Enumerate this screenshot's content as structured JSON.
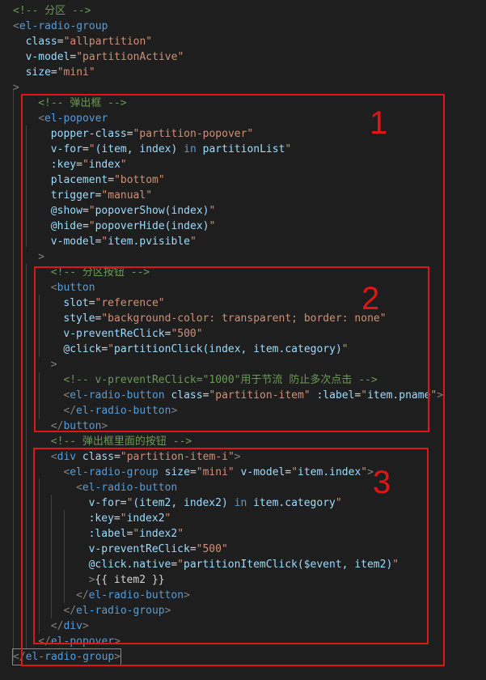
{
  "colors": {
    "background": "#1e1e1e",
    "comment": "#6a9955",
    "tag": "#569cd6",
    "attribute": "#9cdcfe",
    "string": "#ce9178",
    "text": "#d4d4d4",
    "punctuation": "#808080",
    "annotation": "#e01515"
  },
  "annotations": [
    {
      "number": "1"
    },
    {
      "number": "2"
    },
    {
      "number": "3"
    }
  ],
  "code_lines": [
    {
      "indent": 0,
      "tokens": [
        {
          "t": "c",
          "v": "<!-- 分区 -->"
        }
      ]
    },
    {
      "indent": 0,
      "tokens": [
        {
          "t": "p",
          "v": "<"
        },
        {
          "t": "g",
          "v": "el-radio-group"
        }
      ]
    },
    {
      "indent": 1,
      "tokens": [
        {
          "t": "a",
          "v": "class"
        },
        {
          "t": "x",
          "v": "="
        },
        {
          "t": "s",
          "v": "\"allpartition\""
        }
      ]
    },
    {
      "indent": 1,
      "tokens": [
        {
          "t": "a",
          "v": "v-model"
        },
        {
          "t": "x",
          "v": "="
        },
        {
          "t": "s",
          "v": "\"partitionActive\""
        }
      ]
    },
    {
      "indent": 1,
      "tokens": [
        {
          "t": "a",
          "v": "size"
        },
        {
          "t": "x",
          "v": "="
        },
        {
          "t": "s",
          "v": "\"mini\""
        }
      ]
    },
    {
      "indent": 0,
      "tokens": [
        {
          "t": "p",
          "v": ">"
        }
      ]
    },
    {
      "indent": 2,
      "tokens": [
        {
          "t": "c",
          "v": "<!-- 弹出框 -->"
        }
      ]
    },
    {
      "indent": 2,
      "tokens": [
        {
          "t": "p",
          "v": "<"
        },
        {
          "t": "g",
          "v": "el-popover"
        }
      ]
    },
    {
      "indent": 3,
      "tokens": [
        {
          "t": "a",
          "v": "popper-class"
        },
        {
          "t": "x",
          "v": "="
        },
        {
          "t": "s",
          "v": "\"partition-popover\""
        }
      ]
    },
    {
      "indent": 3,
      "tokens": [
        {
          "t": "a",
          "v": "v-for"
        },
        {
          "t": "x",
          "v": "="
        },
        {
          "t": "s",
          "v": "\""
        },
        {
          "t": "a",
          "v": "(item, index) "
        },
        {
          "t": "g",
          "v": "in"
        },
        {
          "t": "a",
          "v": " partitionList"
        },
        {
          "t": "s",
          "v": "\""
        }
      ]
    },
    {
      "indent": 3,
      "tokens": [
        {
          "t": "a",
          "v": ":key"
        },
        {
          "t": "x",
          "v": "="
        },
        {
          "t": "s",
          "v": "\""
        },
        {
          "t": "a",
          "v": "index"
        },
        {
          "t": "s",
          "v": "\""
        }
      ]
    },
    {
      "indent": 3,
      "tokens": [
        {
          "t": "a",
          "v": "placement"
        },
        {
          "t": "x",
          "v": "="
        },
        {
          "t": "s",
          "v": "\"bottom\""
        }
      ]
    },
    {
      "indent": 3,
      "tokens": [
        {
          "t": "a",
          "v": "trigger"
        },
        {
          "t": "x",
          "v": "="
        },
        {
          "t": "s",
          "v": "\"manual\""
        }
      ]
    },
    {
      "indent": 3,
      "tokens": [
        {
          "t": "a",
          "v": "@show"
        },
        {
          "t": "x",
          "v": "="
        },
        {
          "t": "s",
          "v": "\""
        },
        {
          "t": "a",
          "v": "popoverShow(index)"
        },
        {
          "t": "s",
          "v": "\""
        }
      ]
    },
    {
      "indent": 3,
      "tokens": [
        {
          "t": "a",
          "v": "@hide"
        },
        {
          "t": "x",
          "v": "="
        },
        {
          "t": "s",
          "v": "\""
        },
        {
          "t": "a",
          "v": "popoverHide(index)"
        },
        {
          "t": "s",
          "v": "\""
        }
      ]
    },
    {
      "indent": 3,
      "tokens": [
        {
          "t": "a",
          "v": "v-model"
        },
        {
          "t": "x",
          "v": "="
        },
        {
          "t": "s",
          "v": "\""
        },
        {
          "t": "a",
          "v": "item.pvisible"
        },
        {
          "t": "s",
          "v": "\""
        }
      ]
    },
    {
      "indent": 2,
      "tokens": [
        {
          "t": "p",
          "v": ">"
        }
      ]
    },
    {
      "indent": 3,
      "tokens": [
        {
          "t": "c",
          "v": "<!-- 分区按钮 -->"
        }
      ]
    },
    {
      "indent": 3,
      "tokens": [
        {
          "t": "p",
          "v": "<"
        },
        {
          "t": "g",
          "v": "button"
        }
      ]
    },
    {
      "indent": 4,
      "tokens": [
        {
          "t": "a",
          "v": "slot"
        },
        {
          "t": "x",
          "v": "="
        },
        {
          "t": "s",
          "v": "\"reference\""
        }
      ]
    },
    {
      "indent": 4,
      "tokens": [
        {
          "t": "a",
          "v": "style"
        },
        {
          "t": "x",
          "v": "="
        },
        {
          "t": "s",
          "v": "\"background-color: transparent; border: none\""
        }
      ]
    },
    {
      "indent": 4,
      "tokens": [
        {
          "t": "a",
          "v": "v-preventReClick"
        },
        {
          "t": "x",
          "v": "="
        },
        {
          "t": "s",
          "v": "\"500\""
        }
      ]
    },
    {
      "indent": 4,
      "tokens": [
        {
          "t": "a",
          "v": "@click"
        },
        {
          "t": "x",
          "v": "="
        },
        {
          "t": "s",
          "v": "\""
        },
        {
          "t": "a",
          "v": "partitionClick(index, item.category)"
        },
        {
          "t": "s",
          "v": "\""
        }
      ]
    },
    {
      "indent": 3,
      "tokens": [
        {
          "t": "p",
          "v": ">"
        }
      ]
    },
    {
      "indent": 4,
      "tokens": [
        {
          "t": "c",
          "v": "<!-- v-preventReClick=\"1000\"用于节流 防止多次点击 -->"
        }
      ]
    },
    {
      "indent": 4,
      "tokens": [
        {
          "t": "p",
          "v": "<"
        },
        {
          "t": "g",
          "v": "el-radio-button"
        },
        {
          "t": "a",
          "v": " class"
        },
        {
          "t": "x",
          "v": "="
        },
        {
          "t": "s",
          "v": "\"partition-item\""
        },
        {
          "t": "a",
          "v": " :label"
        },
        {
          "t": "x",
          "v": "="
        },
        {
          "t": "s",
          "v": "\""
        },
        {
          "t": "a",
          "v": "item.pname"
        },
        {
          "t": "s",
          "v": "\""
        },
        {
          "t": "p",
          "v": ">"
        }
      ]
    },
    {
      "indent": 4,
      "tokens": [
        {
          "t": "p",
          "v": "</"
        },
        {
          "t": "g",
          "v": "el-radio-button"
        },
        {
          "t": "p",
          "v": ">"
        }
      ]
    },
    {
      "indent": 3,
      "tokens": [
        {
          "t": "p",
          "v": "</"
        },
        {
          "t": "g",
          "v": "button"
        },
        {
          "t": "p",
          "v": ">"
        }
      ]
    },
    {
      "indent": 3,
      "tokens": [
        {
          "t": "c",
          "v": "<!-- 弹出框里面的按钮 -->"
        }
      ]
    },
    {
      "indent": 3,
      "tokens": [
        {
          "t": "p",
          "v": "<"
        },
        {
          "t": "g",
          "v": "div"
        },
        {
          "t": "a",
          "v": " class"
        },
        {
          "t": "x",
          "v": "="
        },
        {
          "t": "s",
          "v": "\"partition-item-i\""
        },
        {
          "t": "p",
          "v": ">"
        }
      ]
    },
    {
      "indent": 4,
      "tokens": [
        {
          "t": "p",
          "v": "<"
        },
        {
          "t": "g",
          "v": "el-radio-group"
        },
        {
          "t": "a",
          "v": " size"
        },
        {
          "t": "x",
          "v": "="
        },
        {
          "t": "s",
          "v": "\"mini\""
        },
        {
          "t": "a",
          "v": " v-model"
        },
        {
          "t": "x",
          "v": "="
        },
        {
          "t": "s",
          "v": "\""
        },
        {
          "t": "a",
          "v": "item.index"
        },
        {
          "t": "s",
          "v": "\""
        },
        {
          "t": "p",
          "v": ">"
        }
      ]
    },
    {
      "indent": 5,
      "tokens": [
        {
          "t": "p",
          "v": "<"
        },
        {
          "t": "g",
          "v": "el-radio-button"
        }
      ]
    },
    {
      "indent": 6,
      "tokens": [
        {
          "t": "a",
          "v": "v-for"
        },
        {
          "t": "x",
          "v": "="
        },
        {
          "t": "s",
          "v": "\""
        },
        {
          "t": "a",
          "v": "(item2, index2) "
        },
        {
          "t": "g",
          "v": "in"
        },
        {
          "t": "a",
          "v": " item.category"
        },
        {
          "t": "s",
          "v": "\""
        }
      ]
    },
    {
      "indent": 6,
      "tokens": [
        {
          "t": "a",
          "v": ":key"
        },
        {
          "t": "x",
          "v": "="
        },
        {
          "t": "s",
          "v": "\""
        },
        {
          "t": "a",
          "v": "index2"
        },
        {
          "t": "s",
          "v": "\""
        }
      ]
    },
    {
      "indent": 6,
      "tokens": [
        {
          "t": "a",
          "v": ":label"
        },
        {
          "t": "x",
          "v": "="
        },
        {
          "t": "s",
          "v": "\""
        },
        {
          "t": "a",
          "v": "index2"
        },
        {
          "t": "s",
          "v": "\""
        }
      ]
    },
    {
      "indent": 6,
      "tokens": [
        {
          "t": "a",
          "v": "v-preventReClick"
        },
        {
          "t": "x",
          "v": "="
        },
        {
          "t": "s",
          "v": "\"500\""
        }
      ]
    },
    {
      "indent": 6,
      "tokens": [
        {
          "t": "a",
          "v": "@click.native"
        },
        {
          "t": "x",
          "v": "="
        },
        {
          "t": "s",
          "v": "\""
        },
        {
          "t": "a",
          "v": "partitionItemClick($event, item2)"
        },
        {
          "t": "s",
          "v": "\""
        }
      ]
    },
    {
      "indent": 6,
      "tokens": [
        {
          "t": "p",
          "v": ">"
        },
        {
          "t": "x",
          "v": "{{ item2 }}"
        }
      ]
    },
    {
      "indent": 5,
      "tokens": [
        {
          "t": "p",
          "v": "</"
        },
        {
          "t": "g",
          "v": "el-radio-button"
        },
        {
          "t": "p",
          "v": ">"
        }
      ]
    },
    {
      "indent": 4,
      "tokens": [
        {
          "t": "p",
          "v": "</"
        },
        {
          "t": "g",
          "v": "el-radio-group"
        },
        {
          "t": "p",
          "v": ">"
        }
      ]
    },
    {
      "indent": 3,
      "tokens": [
        {
          "t": "p",
          "v": "</"
        },
        {
          "t": "g",
          "v": "div"
        },
        {
          "t": "p",
          "v": ">"
        }
      ]
    },
    {
      "indent": 2,
      "tokens": [
        {
          "t": "p",
          "v": "</"
        },
        {
          "t": "g",
          "v": "el-popover"
        },
        {
          "t": "p",
          "v": ">"
        }
      ]
    },
    {
      "indent": 0,
      "tokens": [
        {
          "t": "p",
          "v": "</"
        },
        {
          "t": "g",
          "v": "el-radio-group"
        },
        {
          "t": "p",
          "v": ">"
        }
      ]
    }
  ]
}
